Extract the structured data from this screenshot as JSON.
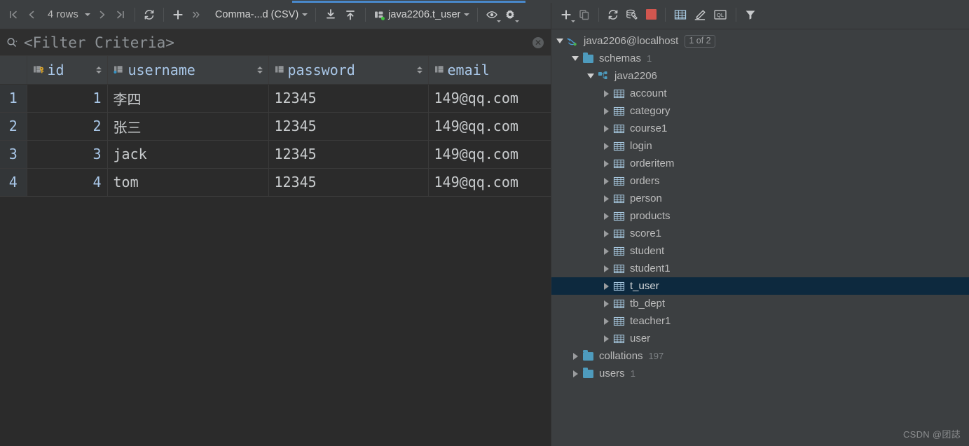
{
  "window": {
    "theme_bg_grid": "#2b2b2b",
    "theme_bg_panel": "#3c3f41",
    "accent_blue": "#4989cc",
    "selection_blue": "#0d293e"
  },
  "progress": {
    "label": "loading-progress"
  },
  "grid_toolbar": {
    "first_page_icon": "first-page-icon",
    "prev_page_icon": "previous-page-icon",
    "rows_label": "4 rows",
    "next_page_icon": "next-page-icon",
    "last_page_icon": "last-page-icon",
    "reload_icon": "reload-icon",
    "add_row_icon": "add-row-icon",
    "more_icon": "chevron-double-right-icon",
    "format_label": "Comma-...d (CSV)",
    "import_icon": "import-icon",
    "export_icon": "export-icon",
    "connection_label": "java2206.t_user",
    "view_options_icon": "eye-icon",
    "settings_icon": "gear-icon"
  },
  "tree_toolbar": {
    "new_icon": "plus-icon",
    "copy_icon": "duplicate-icon",
    "refresh_icon": "refresh-icon",
    "db_tools_icon": "database-tools-icon",
    "stop_icon": "stop-icon",
    "stop_color": "#d1564f",
    "table_icon": "table-icon",
    "edit_icon": "pencil-icon",
    "console_icon": "ql-console-icon",
    "filter_icon": "funnel-icon"
  },
  "filter": {
    "search_icon": "search-icon",
    "placeholder": "<Filter Criteria>",
    "clear_icon": "clear-icon",
    "clear_glyph": "✕"
  },
  "table": {
    "columns": [
      {
        "name": "id",
        "icon": "primary-key-column-icon",
        "align": "right",
        "sortable": true
      },
      {
        "name": "username",
        "icon": "indexed-column-icon",
        "align": "left",
        "sortable": true
      },
      {
        "name": "password",
        "icon": "column-icon",
        "align": "left",
        "sortable": true
      },
      {
        "name": "email",
        "icon": "column-icon",
        "align": "left",
        "sortable": false
      }
    ],
    "rows": [
      {
        "n": "1",
        "id": "1",
        "username": "李四",
        "password": "12345",
        "email": "149@qq.com"
      },
      {
        "n": "2",
        "id": "2",
        "username": "张三",
        "password": "12345",
        "email": "149@qq.com"
      },
      {
        "n": "3",
        "id": "3",
        "username": "jack",
        "password": "12345",
        "email": "149@qq.com"
      },
      {
        "n": "4",
        "id": "4",
        "username": "tom",
        "password": "12345",
        "email": "149@qq.com"
      }
    ]
  },
  "tree": {
    "nodes": [
      {
        "label": "java2206@localhost",
        "icon": "mysql-dolphin-icon",
        "indent": 0,
        "state": "expanded",
        "badge": "1 of 2",
        "selected": false
      },
      {
        "label": "schemas",
        "icon": "folder-icon",
        "indent": 1,
        "state": "expanded",
        "count": "1",
        "selected": false
      },
      {
        "label": "java2206",
        "icon": "schema-icon",
        "indent": 2,
        "state": "expanded",
        "selected": false
      },
      {
        "label": "account",
        "icon": "table-icon",
        "indent": 3,
        "state": "collapsed",
        "selected": false
      },
      {
        "label": "category",
        "icon": "table-icon",
        "indent": 3,
        "state": "collapsed",
        "selected": false
      },
      {
        "label": "course1",
        "icon": "table-icon",
        "indent": 3,
        "state": "collapsed",
        "selected": false
      },
      {
        "label": "login",
        "icon": "table-icon",
        "indent": 3,
        "state": "collapsed",
        "selected": false
      },
      {
        "label": "orderitem",
        "icon": "table-icon",
        "indent": 3,
        "state": "collapsed",
        "selected": false
      },
      {
        "label": "orders",
        "icon": "table-icon",
        "indent": 3,
        "state": "collapsed",
        "selected": false
      },
      {
        "label": "person",
        "icon": "table-icon",
        "indent": 3,
        "state": "collapsed",
        "selected": false
      },
      {
        "label": "products",
        "icon": "table-icon",
        "indent": 3,
        "state": "collapsed",
        "selected": false
      },
      {
        "label": "score1",
        "icon": "table-icon",
        "indent": 3,
        "state": "collapsed",
        "selected": false
      },
      {
        "label": "student",
        "icon": "table-icon",
        "indent": 3,
        "state": "collapsed",
        "selected": false
      },
      {
        "label": "student1",
        "icon": "table-icon",
        "indent": 3,
        "state": "collapsed",
        "selected": false
      },
      {
        "label": "t_user",
        "icon": "table-icon",
        "indent": 3,
        "state": "collapsed",
        "selected": true
      },
      {
        "label": "tb_dept",
        "icon": "table-icon",
        "indent": 3,
        "state": "collapsed",
        "selected": false
      },
      {
        "label": "teacher1",
        "icon": "table-icon",
        "indent": 3,
        "state": "collapsed",
        "selected": false
      },
      {
        "label": "user",
        "icon": "table-icon",
        "indent": 3,
        "state": "collapsed",
        "selected": false
      },
      {
        "label": "collations",
        "icon": "folder-icon",
        "indent": 1,
        "state": "collapsed",
        "count": "197",
        "selected": false
      },
      {
        "label": "users",
        "icon": "folder-icon",
        "indent": 1,
        "state": "collapsed",
        "count": "1",
        "selected": false
      }
    ]
  },
  "watermark": {
    "text": "CSDN @团誌"
  }
}
